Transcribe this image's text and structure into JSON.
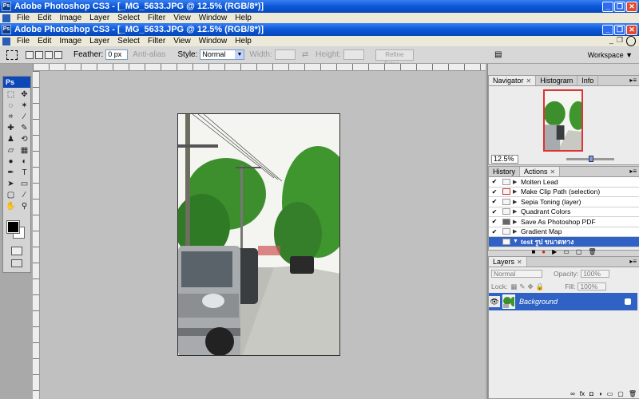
{
  "app_window": {
    "title": "Adobe Photoshop CS3 - [_MG_5633.JPG @ 12.5% (RGB/8*)]",
    "menu": [
      "File",
      "Edit",
      "Image",
      "Layer",
      "Select",
      "Filter",
      "View",
      "Window",
      "Help"
    ]
  },
  "doc_window": {
    "title": "Adobe Photoshop CS3 - [_MG_5633.JPG @ 12.5% (RGB/8*)]",
    "menu": [
      "File",
      "Edit",
      "Image",
      "Layer",
      "Select",
      "Filter",
      "View",
      "Window",
      "Help"
    ]
  },
  "options_bar": {
    "feather_label": "Feather:",
    "feather_value": "0 px",
    "antialias_label": "Anti-alias",
    "style_label": "Style:",
    "style_value": "Normal",
    "width_label": "Width:",
    "height_label": "Height:",
    "refine_edge_label": "Refine Edge...",
    "workspace_label": "Workspace ▼"
  },
  "toolbox": {
    "logo": "Ps"
  },
  "navigator_panel": {
    "tabs": [
      "Navigator",
      "Histogram",
      "Info"
    ],
    "zoom_value": "12.5%"
  },
  "actions_panel": {
    "tabs": [
      "History",
      "Actions"
    ],
    "items": [
      {
        "label": "Molten Lead"
      },
      {
        "label": "Make Clip Path (selection)"
      },
      {
        "label": "Sepia Toning (layer)"
      },
      {
        "label": "Quadrant Colors"
      },
      {
        "label": "Save As Photoshop PDF"
      },
      {
        "label": "Gradient Map"
      },
      {
        "label": "test รูป ขนาดทาง"
      }
    ]
  },
  "layers_panel": {
    "tabs": [
      "Layers"
    ],
    "blend_mode": "Normal",
    "opacity_label": "Opacity:",
    "opacity_value": "100%",
    "lock_label": "Lock:",
    "fill_label": "Fill:",
    "fill_value": "100%",
    "layer_name": "Background"
  },
  "colors": {
    "titlebar_blue": "#0a58d8",
    "selection_blue": "#2f62c4",
    "close_red": "#e04a2c",
    "canvas_gray": "#c0c0c0"
  }
}
